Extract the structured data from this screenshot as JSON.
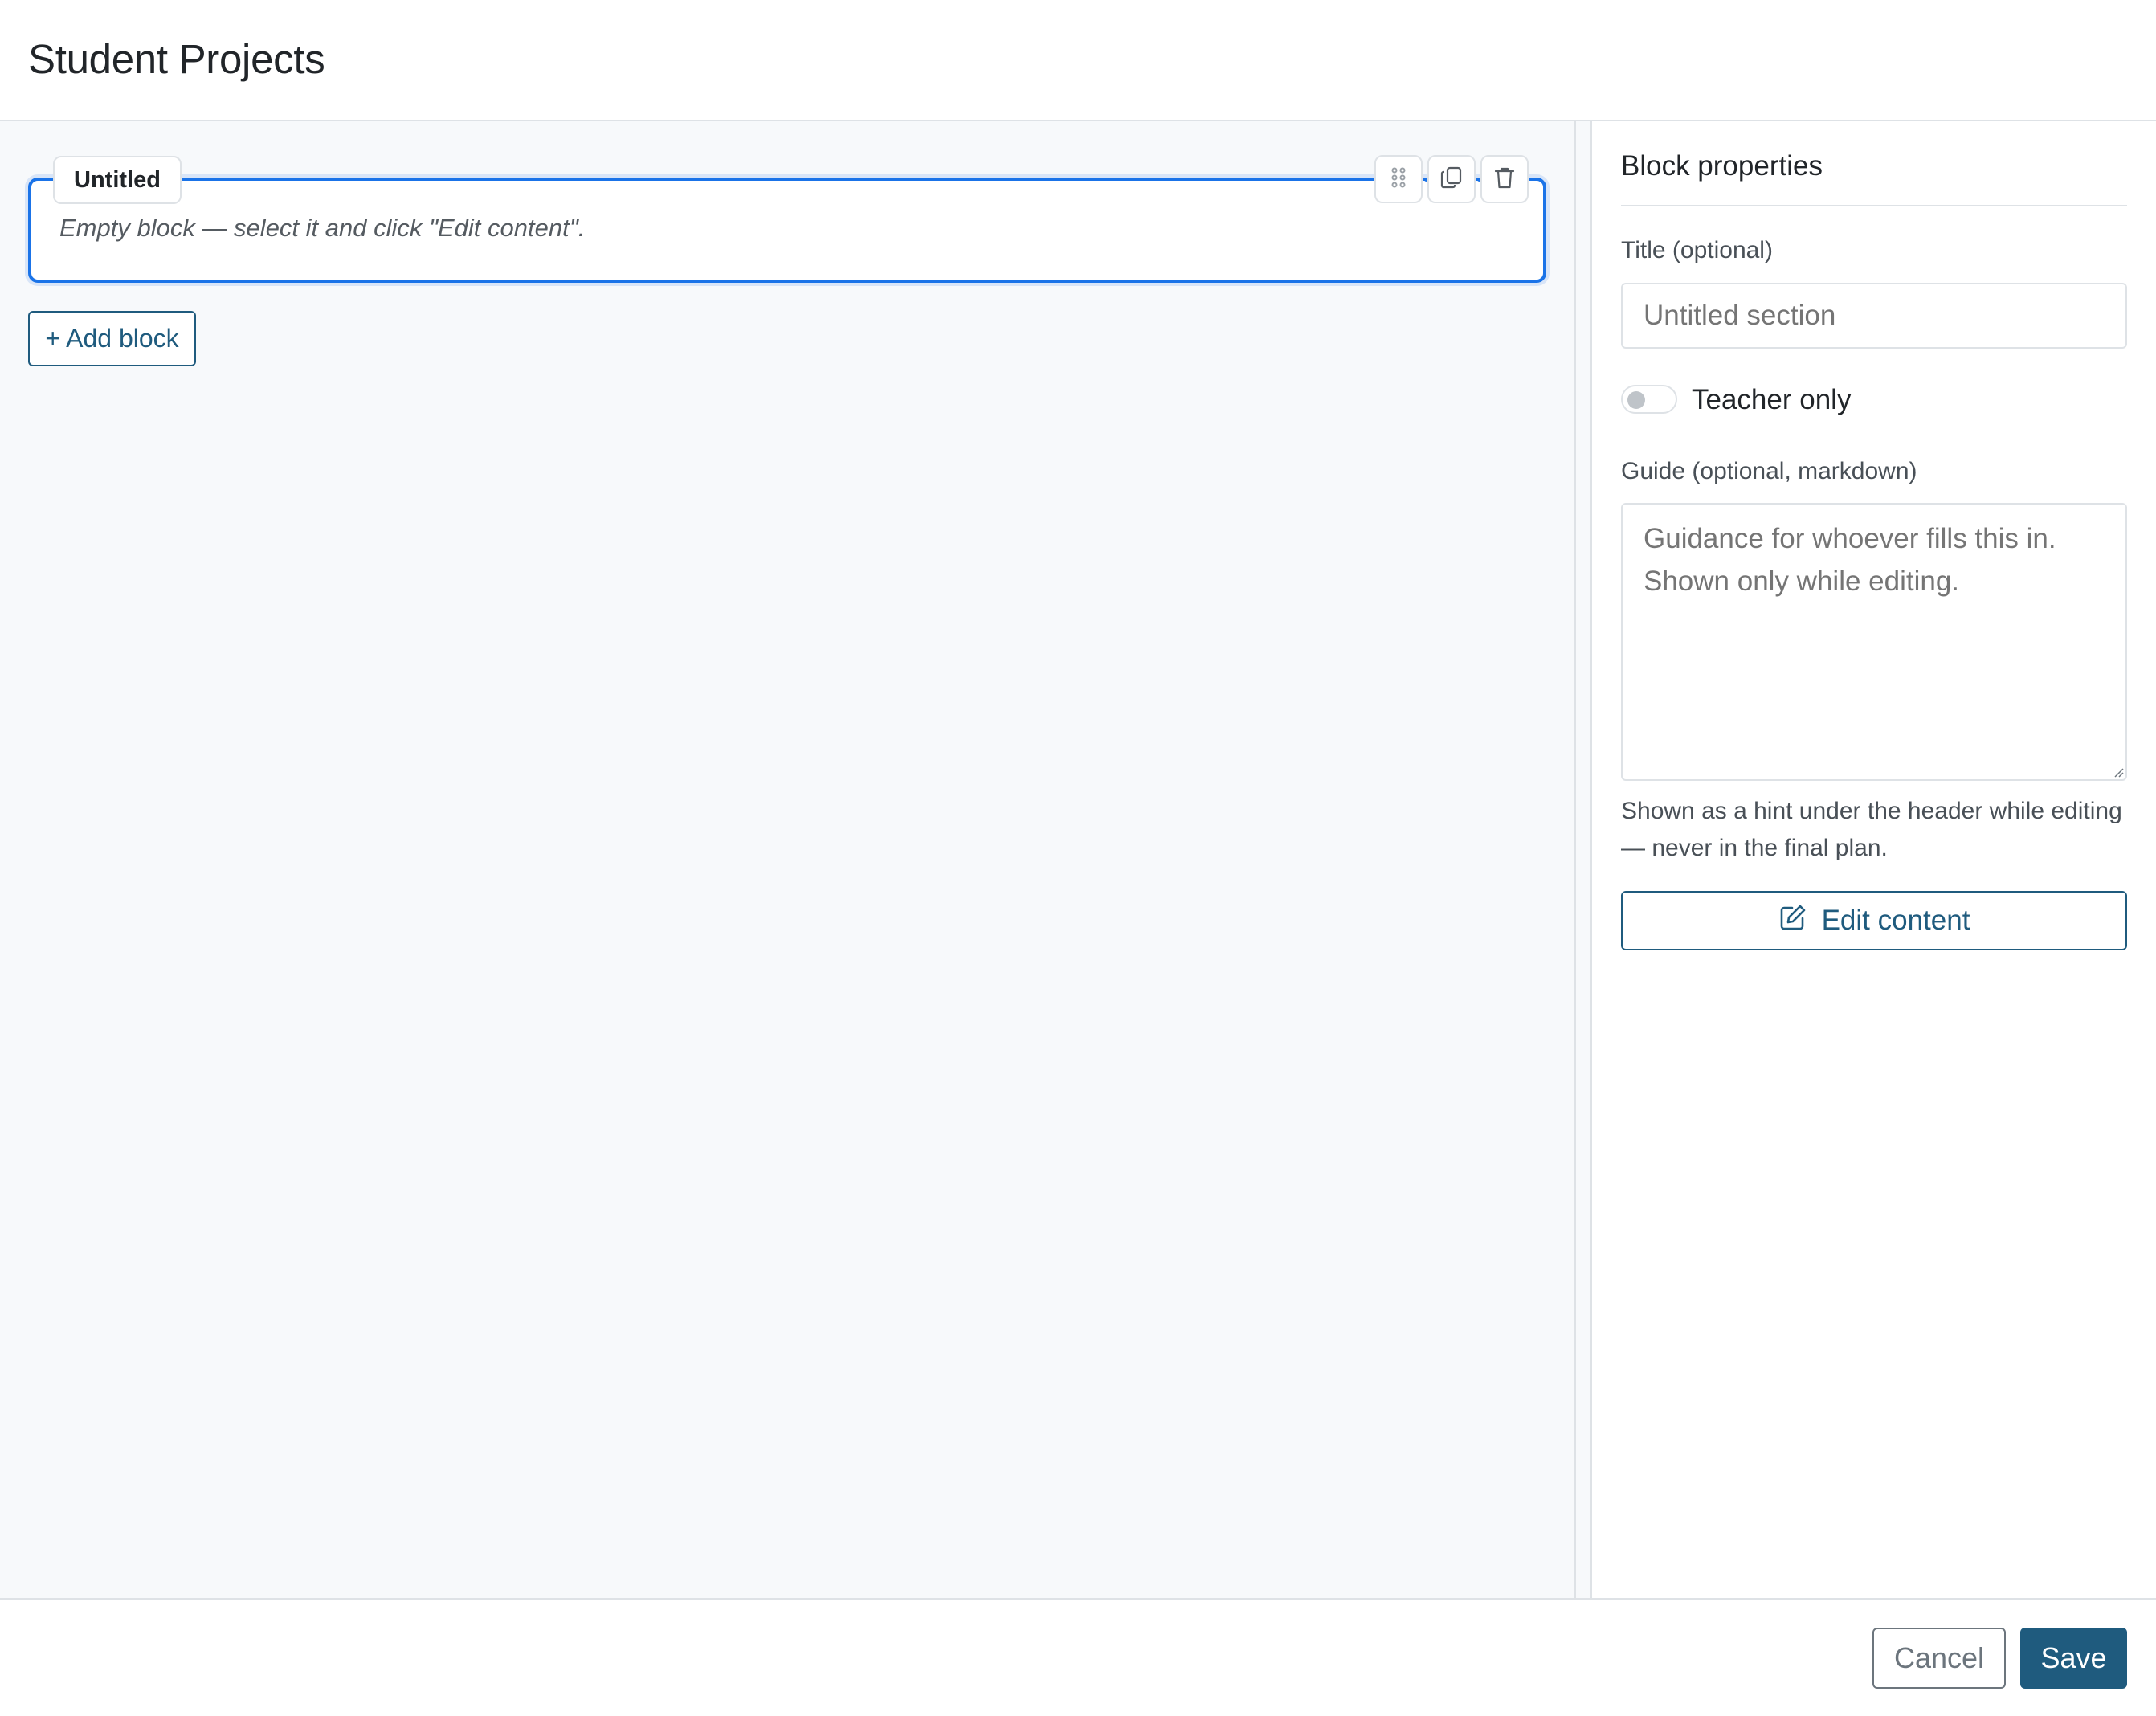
{
  "header": {
    "title": "Student Projects"
  },
  "canvas": {
    "block": {
      "tab_label": "Untitled",
      "placeholder": "Empty block — select it and click \"Edit content\".",
      "tools": [
        "drag-handle-icon",
        "copy-icon",
        "trash-icon"
      ]
    },
    "add_block_label": "+ Add block"
  },
  "panel": {
    "title": "Block properties",
    "title_field": {
      "label": "Title (optional)",
      "placeholder": "Untitled section",
      "value": ""
    },
    "teacher_only": {
      "label": "Teacher only",
      "checked": false
    },
    "guide_field": {
      "label": "Guide (optional, markdown)",
      "placeholder": "Guidance for whoever fills this in. Shown only while editing.",
      "value": ""
    },
    "hint": "Shown as a hint under the header while editing — never in the final plan.",
    "edit_content_label": "Edit content"
  },
  "footer": {
    "cancel_label": "Cancel",
    "save_label": "Save"
  },
  "colors": {
    "accent": "#1a73e8",
    "primary": "#1f5b7e",
    "border": "#dee2e6",
    "canvas_bg": "#f7f9fb"
  }
}
